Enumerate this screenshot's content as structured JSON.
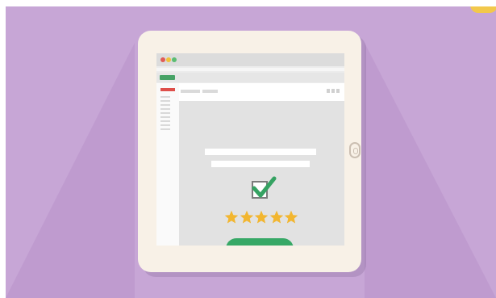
{
  "illustration": {
    "background_color": "#c7a6d6",
    "accent_color": "#f2c84b",
    "tablet_color": "#f8f1e7",
    "screen": {
      "window_dots": [
        "#e05c56",
        "#f0c13a",
        "#5bbd72"
      ],
      "tab_color": "#46a266",
      "sidebar_highlight_color": "#de4f4a",
      "checkbox_checked": true,
      "check_color": "#35a262",
      "rating": {
        "stars_filled": 5,
        "stars_total": 5,
        "star_color": "#f2b630"
      },
      "button_color": "#37a866"
    }
  }
}
